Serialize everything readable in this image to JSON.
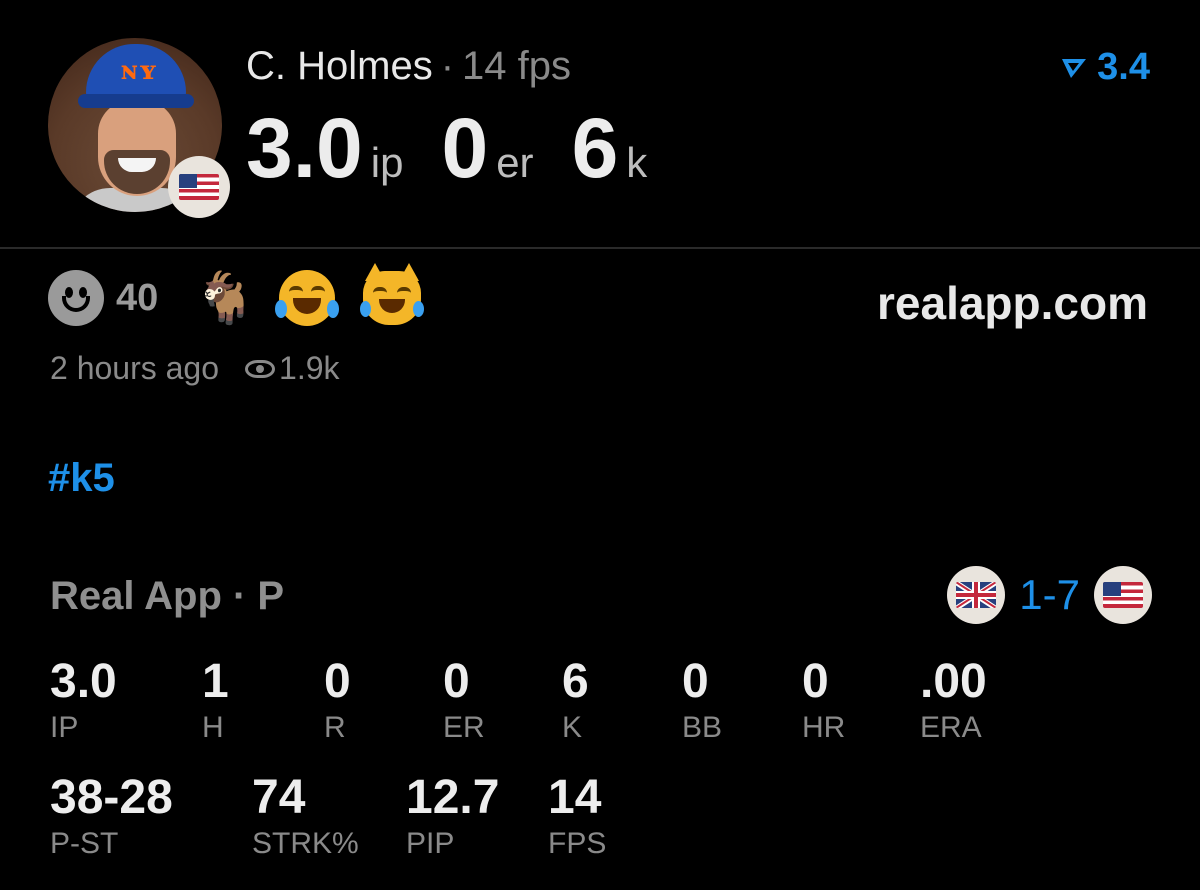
{
  "header": {
    "player_name": "C. Holmes",
    "separator": "·",
    "fps_text": "14 fps",
    "ip_value": "3.0",
    "ip_unit": "ip",
    "er_value": "0",
    "er_unit": "er",
    "k_value": "6",
    "k_unit": "k",
    "rating": "3.4",
    "player_flag": "us-flag-icon"
  },
  "reactions": {
    "smile_count": "40",
    "emojis": [
      "goat",
      "face-with-tears-of-joy",
      "cat-with-tears-of-joy"
    ],
    "site": "realapp.com"
  },
  "meta": {
    "time_ago": "2 hours ago",
    "views": "1.9k"
  },
  "hashtag": "#k5",
  "game": {
    "title": "Real App · P",
    "score": "1-7",
    "away_flag": "uk-flag-icon",
    "home_flag": "us-flag-icon"
  },
  "stats_primary": [
    {
      "value": "3.0",
      "label": "IP"
    },
    {
      "value": "1",
      "label": "H"
    },
    {
      "value": "0",
      "label": "R"
    },
    {
      "value": "0",
      "label": "ER"
    },
    {
      "value": "6",
      "label": "K"
    },
    {
      "value": "0",
      "label": "BB"
    },
    {
      "value": "0",
      "label": "HR"
    },
    {
      "value": ".00",
      "label": "ERA"
    }
  ],
  "stats_secondary": [
    {
      "value": "38-28",
      "label": "P-ST"
    },
    {
      "value": "74",
      "label": "STRK%"
    },
    {
      "value": "12.7",
      "label": "PIP"
    },
    {
      "value": "14",
      "label": "FPS"
    }
  ],
  "colors": {
    "accent": "#1e90e8",
    "background": "#000000",
    "muted": "#8a8a8a"
  }
}
